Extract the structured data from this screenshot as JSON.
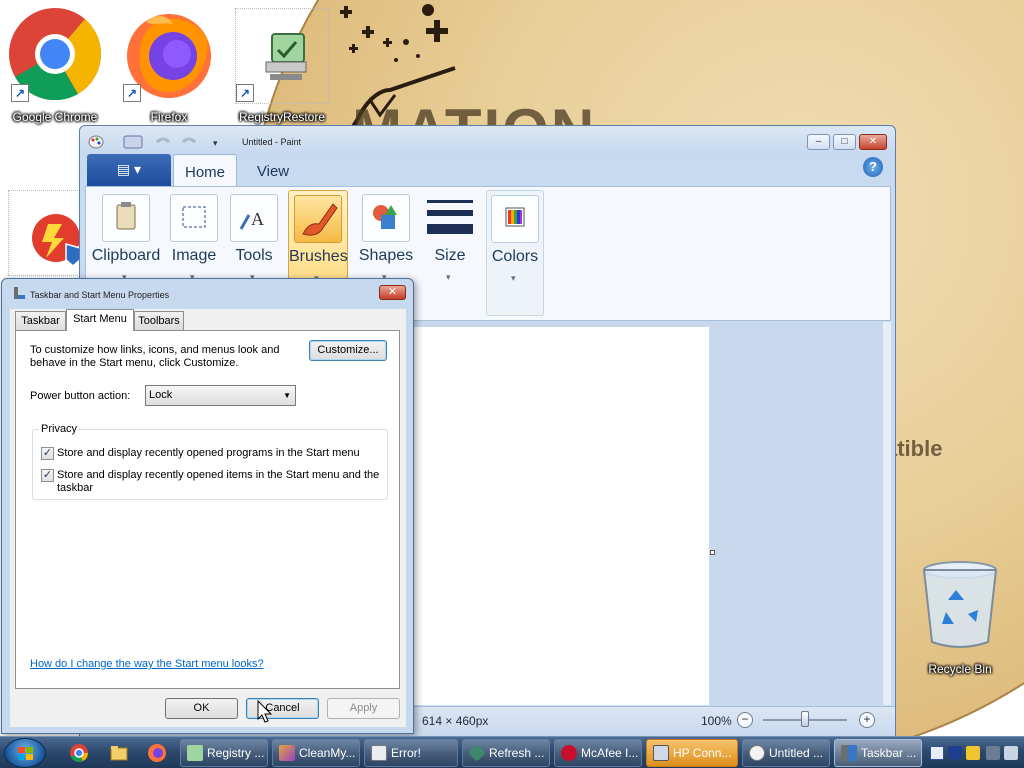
{
  "desktop": {
    "icons": [
      {
        "label": "Google Chrome"
      },
      {
        "label": "Firefox"
      },
      {
        "label": "RegistryRestore"
      },
      {
        "label": "Recycle Bin"
      }
    ],
    "wallpaper_text": {
      "line1": "MATION",
      "line2": "atible"
    }
  },
  "paint": {
    "title": "Untitled - Paint",
    "tabs": [
      {
        "label": "Home"
      },
      {
        "label": "View"
      }
    ],
    "groups": [
      {
        "label": "Clipboard"
      },
      {
        "label": "Image"
      },
      {
        "label": "Tools"
      },
      {
        "label": "Brushes"
      },
      {
        "label": "Shapes"
      },
      {
        "label": "Size"
      },
      {
        "label": "Colors"
      }
    ],
    "status": {
      "canvas_size": "614 × 460px",
      "zoom": "100%"
    }
  },
  "dialog": {
    "title": "Taskbar and Start Menu Properties",
    "tabs": [
      {
        "label": "Taskbar"
      },
      {
        "label": "Start Menu"
      },
      {
        "label": "Toolbars"
      }
    ],
    "intro_line1": "To customize how links, icons, and menus look and",
    "intro_line2": "behave in the Start menu, click Customize.",
    "customize_label": "Customize...",
    "power_label": "Power button action:",
    "power_value": "Lock",
    "privacy_legend": "Privacy",
    "check1_label": "Store and display recently opened programs in the Start menu",
    "check2_line1": "Store and display recently opened items in the Start menu and the",
    "check2_line2": "taskbar",
    "help_link": "How do I change the way the Start menu looks?",
    "ok_label": "OK",
    "cancel_label": "Cancel",
    "apply_label": "Apply"
  },
  "taskbar": {
    "buttons": [
      {
        "label": "Registry ..."
      },
      {
        "label": "CleanMy..."
      },
      {
        "label": "Error!"
      },
      {
        "label": "Refresh ..."
      },
      {
        "label": "McAfee I..."
      },
      {
        "label": "HP Conn..."
      },
      {
        "label": "Untitled ..."
      },
      {
        "label": "Taskbar ..."
      }
    ]
  },
  "colors": {
    "accent_blue": "#1d4c9c",
    "taskbar_highlight": "#de8f1c",
    "link": "#0066cc"
  }
}
